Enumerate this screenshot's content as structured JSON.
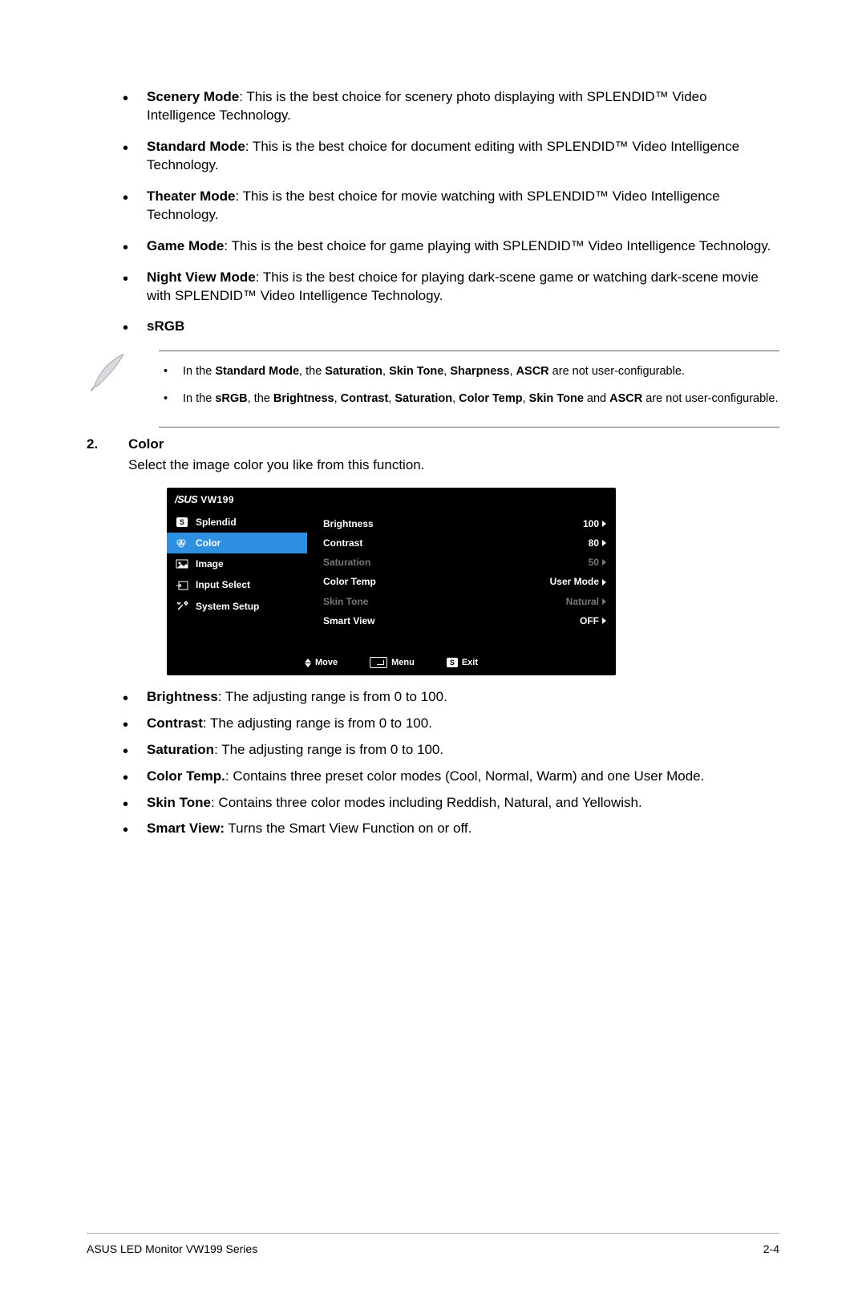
{
  "modes": [
    {
      "name": "Scenery Mode",
      "desc": ": This is the best choice for scenery photo displaying with SPLENDID™ Video Intelligence Technology."
    },
    {
      "name": "Standard Mode",
      "desc": ": This is the best choice for document editing with SPLENDID™ Video Intelligence Technology."
    },
    {
      "name": "Theater Mode",
      "desc": ": This is the best choice for movie watching with SPLENDID™ Video Intelligence Technology."
    },
    {
      "name": "Game Mode",
      "desc": ": This is the best choice for game playing with SPLENDID™ Video Intelligence Technology."
    },
    {
      "name": "Night View Mode",
      "desc": ": This is the best choice for playing dark-scene game or watching dark-scene movie with SPLENDID™ Video Intelligence Technology."
    },
    {
      "name": "sRGB",
      "desc": ""
    }
  ],
  "note": {
    "line1_pre": "In the ",
    "line1_b1": "Standard Mode",
    "line1_mid1": ", the ",
    "line1_b2": "Saturation",
    "line1_c1": ", ",
    "line1_b3": "Skin Tone",
    "line1_c2": ", ",
    "line1_b4": "Sharpness",
    "line1_c3": ", ",
    "line1_b5": "ASCR",
    "line1_post": " are not user-configurable.",
    "line2_pre": "In the ",
    "line2_b1": "sRGB",
    "line2_mid1": ", the ",
    "line2_b2": "Brightness",
    "line2_c1": ", ",
    "line2_b3": "Contrast",
    "line2_c2": ", ",
    "line2_b4": "Saturation",
    "line2_c3": ", ",
    "line2_b5": "Color Temp",
    "line2_c4": ", ",
    "line2_b6": "Skin Tone",
    "line2_mid2": " and ",
    "line2_b7": "ASCR",
    "line2_post": " are not user-configurable."
  },
  "section": {
    "num": "2.",
    "title": "Color",
    "desc": "Select the image color you like from this function."
  },
  "osd": {
    "brand": "/SUS",
    "model": "VW199",
    "menu": [
      {
        "icon": "s-badge",
        "label": "Splendid",
        "selected": false
      },
      {
        "icon": "color-icon",
        "label": "Color",
        "selected": true
      },
      {
        "icon": "image-icon",
        "label": "Image",
        "selected": false
      },
      {
        "icon": "input-icon",
        "label": "Input Select",
        "selected": false
      },
      {
        "icon": "tools-icon",
        "label": "System Setup",
        "selected": false
      }
    ],
    "settings": [
      {
        "label": "Brightness",
        "value": "100",
        "dim": false
      },
      {
        "label": "Contrast",
        "value": "80",
        "dim": false
      },
      {
        "label": "Saturation",
        "value": "50",
        "dim": true
      },
      {
        "label": "Color Temp",
        "value": "User Mode",
        "dim": false
      },
      {
        "label": "Skin Tone",
        "value": "Natural",
        "dim": true
      },
      {
        "label": "Smart View",
        "value": "OFF",
        "dim": false
      }
    ],
    "footer": {
      "move": "Move",
      "menu": "Menu",
      "exit": "Exit"
    }
  },
  "params": [
    {
      "name": "Brightness",
      "desc": ": The adjusting range is from 0 to 100."
    },
    {
      "name": "Contrast",
      "desc": ": The adjusting range is from 0 to 100."
    },
    {
      "name": "Saturation",
      "desc": ": The adjusting range is from 0 to 100."
    },
    {
      "name": "Color Temp.",
      "desc": ": Contains three preset color modes (Cool, Normal, Warm) and one User Mode."
    },
    {
      "name": "Skin Tone",
      "desc": ": Contains three color modes including Reddish, Natural, and Yellowish."
    },
    {
      "name": "Smart View:",
      "desc": " Turns the Smart View Function on or off."
    }
  ],
  "footer": {
    "left": "ASUS LED Monitor VW199 Series",
    "right": "2-4"
  }
}
